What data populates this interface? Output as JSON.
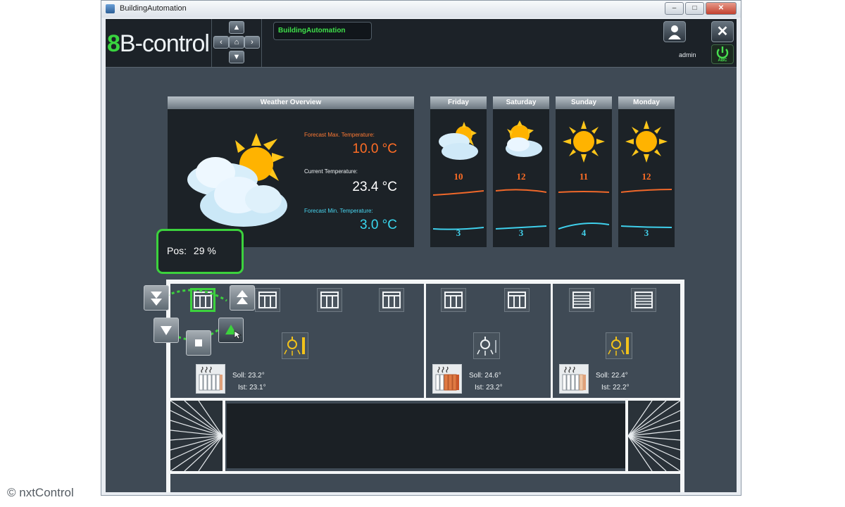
{
  "window": {
    "title": "BuildingAutomation",
    "buttons": {
      "minimize": "–",
      "maximize": "□",
      "close": "✕"
    }
  },
  "app": {
    "logo": {
      "prefix": "8",
      "text": "B-control"
    },
    "nav": {
      "up": "▲",
      "left": "‹",
      "home": "⌂",
      "right": "›",
      "down": "▼"
    },
    "tab": "BuildingAutomation",
    "user": "admin",
    "close_label": "✕",
    "power_label": "ABC"
  },
  "weather": {
    "title": "Weather Overview",
    "max_label": "Forecast Max. Temperature:",
    "max_value": "10.0 °C",
    "current_label": "Current Temperature:",
    "current_value": "23.4 °C",
    "min_label": "Forecast Min. Temperature:",
    "min_value": "3.0 °C"
  },
  "forecast": [
    {
      "day": "Friday",
      "high": "10",
      "low": "3",
      "icon": "sun-cloud-icon"
    },
    {
      "day": "Saturday",
      "high": "12",
      "low": "3",
      "icon": "sun-cloud-icon"
    },
    {
      "day": "Sunday",
      "high": "11",
      "low": "4",
      "icon": "sun-icon"
    },
    {
      "day": "Monday",
      "high": "12",
      "low": "3",
      "icon": "sun-icon"
    }
  ],
  "tooltip": {
    "label": "Pos:",
    "value": "29 %"
  },
  "rooms": [
    {
      "soll": "Soll: 23.2°",
      "ist": "Ist: 23.1°"
    },
    {
      "soll": "Soll: 24.6°",
      "ist": "Ist: 23.2°"
    },
    {
      "soll": "Soll: 22.4°",
      "ist": "Ist: 22.2°"
    }
  ],
  "credit": "© nxtControl",
  "colors": {
    "accent_green": "#3cd23d",
    "hot": "#ff6d25",
    "cold": "#43d2ec",
    "lamp_yellow": "#f2c21a"
  }
}
